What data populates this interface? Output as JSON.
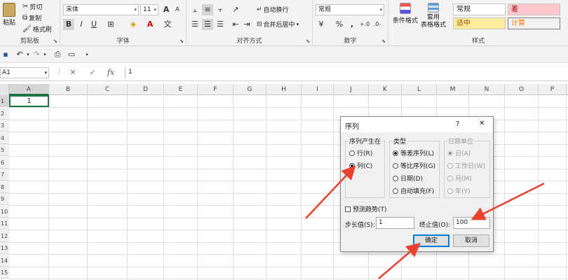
{
  "ribbon": {
    "clipboard": {
      "paste": "粘贴",
      "cut": "剪切",
      "copy": "复制",
      "format_painter": "格式刷",
      "label": "剪贴板"
    },
    "font": {
      "name": "宋体",
      "size": "11",
      "bold": "B",
      "italic": "I",
      "underline": "U",
      "grow": "A",
      "shrink": "A",
      "label": "字体"
    },
    "alignment": {
      "wrap": "自动换行",
      "merge": "合并后居中",
      "label": "对齐方式"
    },
    "number": {
      "format": "常规",
      "percent": "%",
      "comma": ",",
      "label": "数字"
    },
    "styles": {
      "conditional": "条件格式",
      "table_line1": "套用",
      "table_line2": "表格格式",
      "normal": "常规",
      "bad": "差",
      "neutral": "适中",
      "calc": "计算",
      "label": "样式"
    }
  },
  "formula_bar": {
    "cell_ref": "A1",
    "cancel": "✕",
    "enter": "✓",
    "fx": "fx",
    "value": "1"
  },
  "grid": {
    "columns": [
      "A",
      "B",
      "C",
      "D",
      "E",
      "F",
      "G",
      "H",
      "I",
      "J",
      "K",
      "L",
      "M",
      "N",
      "O",
      "P"
    ],
    "rows": [
      "1",
      "2",
      "3",
      "4",
      "5",
      "6",
      "7",
      "8",
      "9",
      "10",
      "11",
      "12",
      "13",
      "14",
      "15"
    ],
    "a1_value": "1"
  },
  "dialog": {
    "title": "序列",
    "help": "?",
    "close": "✕",
    "series_in": {
      "label": "序列产生在",
      "row": "行(R)",
      "column": "列(C)"
    },
    "type": {
      "label": "类型",
      "linear": "等差序列(L)",
      "growth": "等比序列(G)",
      "date": "日期(D)",
      "autofill": "自动填充(F)"
    },
    "date_unit": {
      "label": "日期单位",
      "day": "日(A)",
      "weekday": "工作日(W)",
      "month": "月(M)",
      "year": "年(Y)"
    },
    "trend": "预测趋势(T)",
    "step_label": "步长值(S):",
    "step_value": "1",
    "stop_label": "终止值(O):",
    "stop_value": "100",
    "ok": "确定",
    "cancel": "取消"
  },
  "colors": {
    "accent": "#217346",
    "arrow": "#e8412c",
    "bad_bg": "#ffc7ce",
    "bad_fg": "#9c0006",
    "neutral_bg": "#ffeb9c",
    "neutral_fg": "#9c5700",
    "calc_bg": "#f2f2f2",
    "calc_fg": "#fa7d00"
  }
}
